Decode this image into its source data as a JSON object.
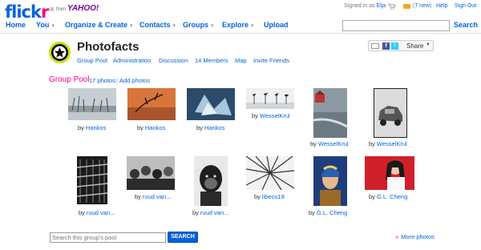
{
  "header": {
    "logo": {
      "text": "flickr",
      "tagline": "from",
      "partner": "YAHOO!"
    },
    "signed_in_prefix": "Signed in as",
    "user": "Elja",
    "new_messages": "7 new",
    "help": "Help",
    "sign_out": "Sign Out"
  },
  "nav": {
    "items": [
      {
        "label": "Home"
      },
      {
        "label": "You",
        "dropdown": true
      },
      {
        "label": "Organize & Create",
        "dropdown": true
      },
      {
        "label": "Contacts",
        "dropdown": true
      },
      {
        "label": "Groups",
        "dropdown": true
      },
      {
        "label": "Explore",
        "dropdown": true
      },
      {
        "label": "Upload"
      }
    ],
    "search_label": "Search",
    "search_value": ""
  },
  "group": {
    "title": "Photofacts",
    "links": [
      "Group Pool",
      "Administration",
      "Discussion",
      "14 Members",
      "Map",
      "Invite Friends"
    ],
    "share_label": "Share",
    "fb": "f",
    "tw": "t"
  },
  "pool": {
    "title": "Group Pool",
    "count": "17 photos",
    "add": "Add photos",
    "by": "by",
    "rows": [
      [
        {
          "author": "Hankos",
          "scene": "reeds-water"
        },
        {
          "author": "Hankos",
          "scene": "branch-orange"
        },
        {
          "author": "Hankos",
          "scene": "ice-blue"
        },
        {
          "author": "WesselKrul",
          "scene": "bare-trees"
        },
        {
          "author": "WesselKrul",
          "scene": "shore-house"
        },
        {
          "author": "WesselKrul",
          "scene": "old-car"
        }
      ],
      [
        {
          "author": "ruud van...",
          "scene": "stairs"
        },
        {
          "author": "ruud van...",
          "scene": "crowd"
        },
        {
          "author": "ruud van...",
          "scene": "chimpanzee"
        },
        {
          "author": "libeco18",
          "scene": "forest-up"
        },
        {
          "author": "G.L. Cheng",
          "scene": "pearl-earring"
        },
        {
          "author": "G.L. Cheng",
          "scene": "woman-red"
        }
      ]
    ],
    "search_placeholder": "Search this group's pool",
    "search_button": "SEARCH",
    "more": "More photos",
    "more_arrows": "»"
  },
  "colors": {
    "brand_blue": "#0063dc",
    "brand_pink": "#ff0084"
  }
}
